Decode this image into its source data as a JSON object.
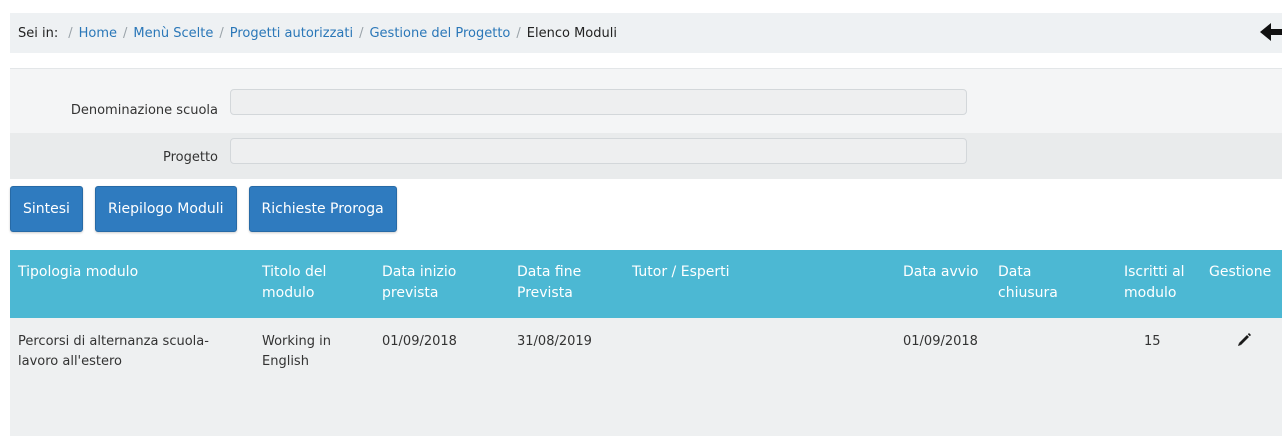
{
  "breadcrumb": {
    "prefix": "Sei in:",
    "items": [
      "Home",
      "Menù Scelte",
      "Progetti autorizzati",
      "Gestione del Progetto"
    ],
    "current": "Elenco Moduli"
  },
  "form": {
    "school_label": "Denominazione scuola",
    "project_label": "Progetto"
  },
  "buttons": {
    "sintesi": "Sintesi",
    "riepilogo": "Riepilogo Moduli",
    "proroga": "Richieste Proroga"
  },
  "table": {
    "headers": {
      "tipologia": "Tipologia modulo",
      "titolo": "Titolo del modulo",
      "inizio": "Data inizio prevista",
      "fine": "Data fine Prevista",
      "tutor": "Tutor / Esperti",
      "avvio": "Data avvio",
      "chiusura": "Data chiusura",
      "iscritti": "Iscritti al modulo",
      "gestione": "Gestione"
    },
    "rows": [
      {
        "tipologia": "Percorsi di alternanza scuola-lavoro all'estero",
        "titolo": "Working in English",
        "inizio": "01/09/2018",
        "fine": "31/08/2019",
        "tutor": "",
        "avvio": "01/09/2018",
        "chiusura": "",
        "iscritti": "15"
      }
    ]
  },
  "colors": {
    "header_bg": "#4cb8d3",
    "button_bg": "#2f7bbf",
    "link": "#2a77b8"
  }
}
